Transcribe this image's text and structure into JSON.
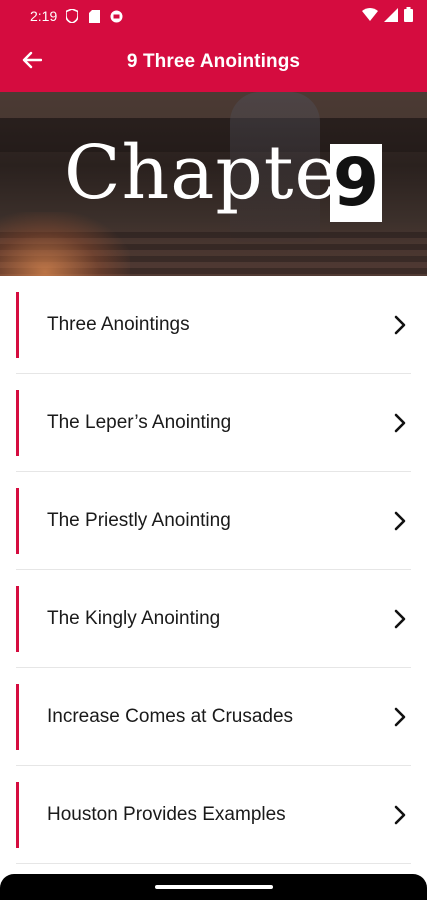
{
  "status_bar": {
    "time": "2:19",
    "icons": [
      "shield-icon",
      "sim-card-icon",
      "app-notification-icon"
    ],
    "right_icons": [
      "wifi-icon",
      "signal-icon",
      "battery-icon"
    ]
  },
  "app_bar": {
    "title": "9 Three Anointings",
    "back_icon": "arrow-left-icon"
  },
  "banner": {
    "word": "Chapter",
    "number": "9"
  },
  "list": {
    "items": [
      {
        "label": "Three Anointings"
      },
      {
        "label": "The Leper’s Anointing"
      },
      {
        "label": "The Priestly Anointing"
      },
      {
        "label": "The Kingly Anointing"
      },
      {
        "label": "Increase Comes at Crusades"
      },
      {
        "label": "Houston Provides Examples"
      }
    ]
  },
  "colors": {
    "brand": "#d50c3f",
    "text": "#1a1a1a",
    "divider": "#e6e6e6"
  }
}
